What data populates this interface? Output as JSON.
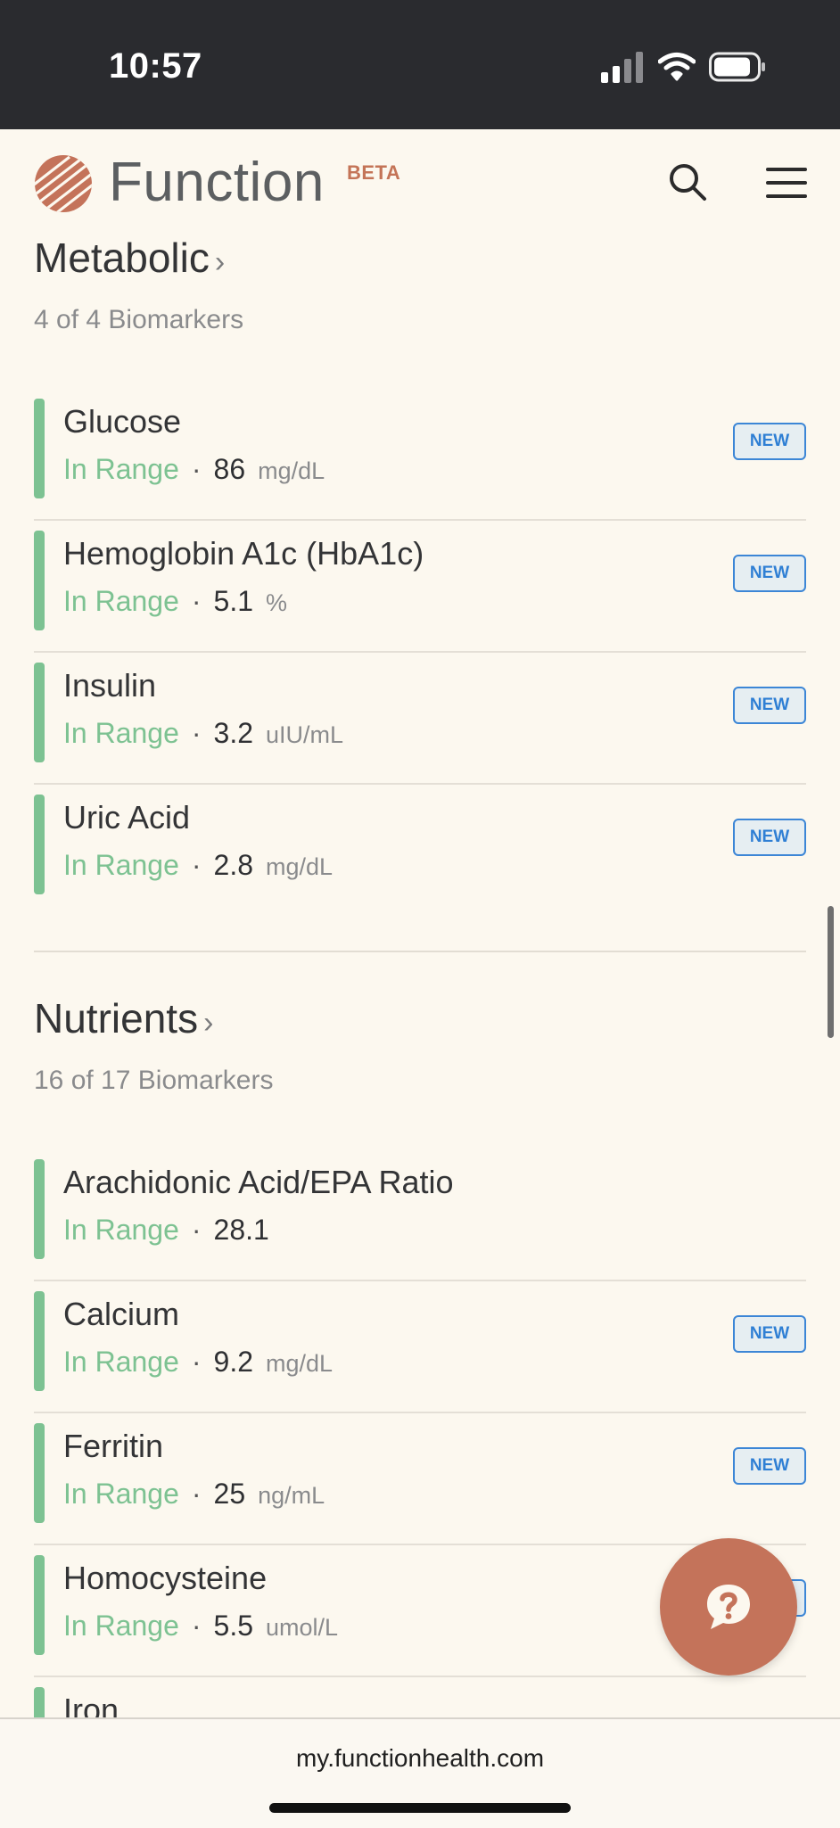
{
  "status_bar": {
    "time": "10:57"
  },
  "header": {
    "brand": "Function",
    "badge": "BETA"
  },
  "sections": [
    {
      "title": "Metabolic",
      "subtitle": "4 of 4 Biomarkers",
      "items": [
        {
          "name": "Glucose",
          "status": "In Range",
          "value": "86",
          "unit": "mg/dL",
          "badge": "NEW"
        },
        {
          "name": "Hemoglobin A1c (HbA1c)",
          "status": "In Range",
          "value": "5.1",
          "unit": "%",
          "badge": "NEW"
        },
        {
          "name": "Insulin",
          "status": "In Range",
          "value": "3.2",
          "unit": "uIU/mL",
          "badge": "NEW"
        },
        {
          "name": "Uric Acid",
          "status": "In Range",
          "value": "2.8",
          "unit": "mg/dL",
          "badge": "NEW"
        }
      ]
    },
    {
      "title": "Nutrients",
      "subtitle": "16 of 17 Biomarkers",
      "items": [
        {
          "name": "Arachidonic Acid/EPA Ratio",
          "status": "In Range",
          "value": "28.1",
          "unit": "",
          "badge": ""
        },
        {
          "name": "Calcium",
          "status": "In Range",
          "value": "9.2",
          "unit": "mg/dL",
          "badge": "NEW"
        },
        {
          "name": "Ferritin",
          "status": "In Range",
          "value": "25",
          "unit": "ng/mL",
          "badge": "NEW"
        },
        {
          "name": "Homocysteine",
          "status": "In Range",
          "value": "5.5",
          "unit": "umol/L",
          "badge": "NEW"
        },
        {
          "name": "Iron"
        }
      ]
    }
  ],
  "separator": "·",
  "chevron": "›",
  "help_button": {
    "icon": "question-chat-icon"
  },
  "browser": {
    "url": "my.functionhealth.com"
  },
  "colors": {
    "in_range": "#7dc292",
    "brand_accent": "#c4735a",
    "badge_blue": "#2f7fd4",
    "background": "#fcf8ef"
  }
}
